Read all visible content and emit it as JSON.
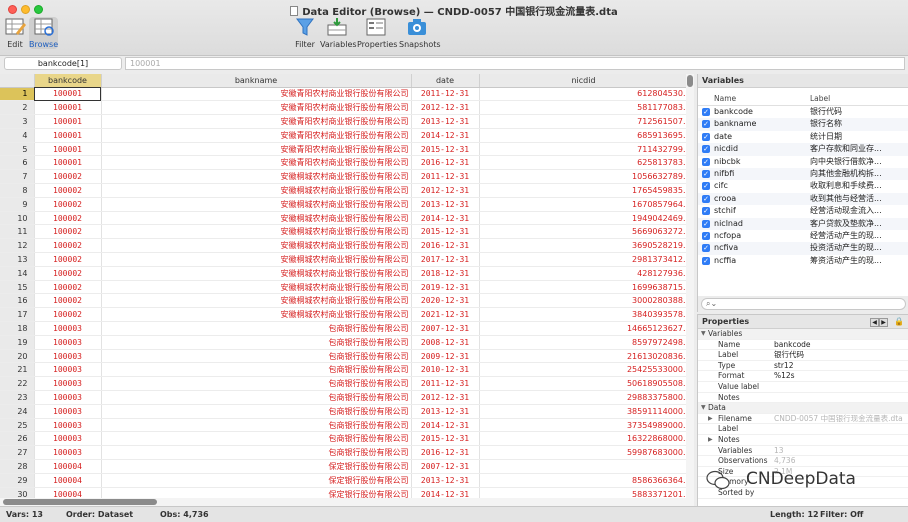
{
  "window": {
    "title": "Data Editor (Browse) — CNDD-0057 中国银行现金流量表.dta"
  },
  "toolbar": {
    "edit": "Edit",
    "browse": "Browse",
    "filter": "Filter",
    "variables": "Variables",
    "properties": "Properties",
    "snapshots": "Snapshots"
  },
  "cellbar": {
    "ref": "bankcode[1]",
    "value": "100001"
  },
  "grid": {
    "columns": [
      "bankcode",
      "bankname",
      "date",
      "nicdid"
    ],
    "rows": [
      [
        "1",
        "100001",
        "安徽青阳农村商业银行股份有限公司",
        "2011-12-31",
        "612804530."
      ],
      [
        "2",
        "100001",
        "安徽青阳农村商业银行股份有限公司",
        "2012-12-31",
        "581177083."
      ],
      [
        "3",
        "100001",
        "安徽青阳农村商业银行股份有限公司",
        "2013-12-31",
        "712561507."
      ],
      [
        "4",
        "100001",
        "安徽青阳农村商业银行股份有限公司",
        "2014-12-31",
        "685913695."
      ],
      [
        "5",
        "100001",
        "安徽青阳农村商业银行股份有限公司",
        "2015-12-31",
        "711432799."
      ],
      [
        "6",
        "100001",
        "安徽青阳农村商业银行股份有限公司",
        "2016-12-31",
        "625813783."
      ],
      [
        "7",
        "100002",
        "安徽桐城农村商业银行股份有限公司",
        "2011-12-31",
        "1056632789."
      ],
      [
        "8",
        "100002",
        "安徽桐城农村商业银行股份有限公司",
        "2012-12-31",
        "1765459835."
      ],
      [
        "9",
        "100002",
        "安徽桐城农村商业银行股份有限公司",
        "2013-12-31",
        "1670857964."
      ],
      [
        "10",
        "100002",
        "安徽桐城农村商业银行股份有限公司",
        "2014-12-31",
        "1949042469."
      ],
      [
        "11",
        "100002",
        "安徽桐城农村商业银行股份有限公司",
        "2015-12-31",
        "5669063272."
      ],
      [
        "12",
        "100002",
        "安徽桐城农村商业银行股份有限公司",
        "2016-12-31",
        "3690528219."
      ],
      [
        "13",
        "100002",
        "安徽桐城农村商业银行股份有限公司",
        "2017-12-31",
        "2981373412."
      ],
      [
        "14",
        "100002",
        "安徽桐城农村商业银行股份有限公司",
        "2018-12-31",
        "428127936."
      ],
      [
        "15",
        "100002",
        "安徽桐城农村商业银行股份有限公司",
        "2019-12-31",
        "1699638715."
      ],
      [
        "16",
        "100002",
        "安徽桐城农村商业银行股份有限公司",
        "2020-12-31",
        "3000280388."
      ],
      [
        "17",
        "100002",
        "安徽桐城农村商业银行股份有限公司",
        "2021-12-31",
        "3840393578."
      ],
      [
        "18",
        "100003",
        "包商银行股份有限公司",
        "2007-12-31",
        "14665123627."
      ],
      [
        "19",
        "100003",
        "包商银行股份有限公司",
        "2008-12-31",
        "8597972498."
      ],
      [
        "20",
        "100003",
        "包商银行股份有限公司",
        "2009-12-31",
        "21613020836."
      ],
      [
        "21",
        "100003",
        "包商银行股份有限公司",
        "2010-12-31",
        "25425533000."
      ],
      [
        "22",
        "100003",
        "包商银行股份有限公司",
        "2011-12-31",
        "50618905508."
      ],
      [
        "23",
        "100003",
        "包商银行股份有限公司",
        "2012-12-31",
        "29883375800."
      ],
      [
        "24",
        "100003",
        "包商银行股份有限公司",
        "2013-12-31",
        "38591114000."
      ],
      [
        "25",
        "100003",
        "包商银行股份有限公司",
        "2014-12-31",
        "37354989000."
      ],
      [
        "26",
        "100003",
        "包商银行股份有限公司",
        "2015-12-31",
        "16322868000."
      ],
      [
        "27",
        "100003",
        "包商银行股份有限公司",
        "2016-12-31",
        "59987683000."
      ],
      [
        "28",
        "100004",
        "保定银行股份有限公司",
        "2007-12-31",
        ""
      ],
      [
        "29",
        "100004",
        "保定银行股份有限公司",
        "2013-12-31",
        "8586366364."
      ],
      [
        "30",
        "100004",
        "保定银行股份有限公司",
        "2014-12-31",
        "5883371201."
      ]
    ]
  },
  "variables": {
    "title": "Variables",
    "col_name": "Name",
    "col_label": "Label",
    "items": [
      {
        "name": "bankcode",
        "label": "银行代码"
      },
      {
        "name": "bankname",
        "label": "银行名称"
      },
      {
        "name": "date",
        "label": "统计日期"
      },
      {
        "name": "nicdid",
        "label": "客户存款和同业存..."
      },
      {
        "name": "nibcbk",
        "label": "向中央银行借款净..."
      },
      {
        "name": "nifbfi",
        "label": "向其他金融机构拆..."
      },
      {
        "name": "cifc",
        "label": "收取利息和手续费..."
      },
      {
        "name": "crooa",
        "label": "收到其他与经营活..."
      },
      {
        "name": "stchif",
        "label": "经营活动现金流入..."
      },
      {
        "name": "niclnad",
        "label": "客户贷款及垫款净..."
      },
      {
        "name": "ncfopa",
        "label": "经营活动产生的现..."
      },
      {
        "name": "ncfiva",
        "label": "投资活动产生的现..."
      },
      {
        "name": "ncffia",
        "label": "筹资活动产生的现..."
      }
    ]
  },
  "properties": {
    "title": "Properties",
    "variables_section": "Variables",
    "var_fields": [
      {
        "key": "Name",
        "value": "bankcode"
      },
      {
        "key": "Label",
        "value": "银行代码"
      },
      {
        "key": "Type",
        "value": "str12"
      },
      {
        "key": "Format",
        "value": "%12s"
      },
      {
        "key": "Value label",
        "value": ""
      },
      {
        "key": "Notes",
        "value": ""
      }
    ],
    "data_section": "Data",
    "data_fields": [
      {
        "key": "Filename",
        "value": "CNDD-0057 中国银行现金流量表.dta"
      },
      {
        "key": "Label",
        "value": ""
      },
      {
        "key": "Notes",
        "value": ""
      },
      {
        "key": "Variables",
        "value": "13"
      },
      {
        "key": "Observations",
        "value": "4,736"
      },
      {
        "key": "Size",
        "value": "2.1M"
      },
      {
        "key": "Memory",
        "value": ""
      },
      {
        "key": "Sorted by",
        "value": ""
      }
    ]
  },
  "watermark": {
    "text": "CNDeepData"
  },
  "status": {
    "vars": "Vars: 13",
    "order": "Order: Dataset",
    "obs": "Obs: 4,736",
    "length": "Length: 12",
    "filter": "Filter: Off"
  }
}
